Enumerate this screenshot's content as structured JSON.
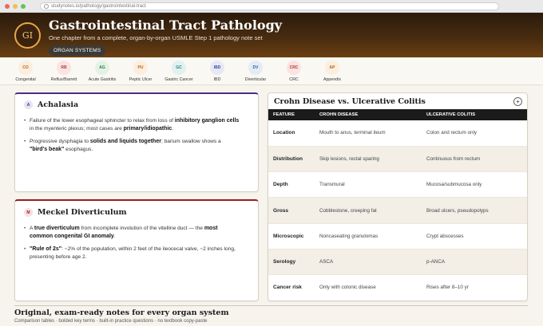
{
  "browser": {
    "url": "studynotes.io/pathology/gastrointestinal-tract"
  },
  "hero": {
    "badge": "GI",
    "title": "Gastrointestinal Tract Pathology",
    "subtitle": "One chapter from a complete, organ-by-organ USMLE Step 1 pathology note set",
    "pill": "ORGAN SYSTEMS"
  },
  "nav": [
    {
      "abbr": "CO",
      "label": "Congenital",
      "bg": "#fbeede",
      "fg": "#b5651d"
    },
    {
      "abbr": "RB",
      "label": "Reflux/Barrett",
      "bg": "#fbe3e3",
      "fg": "#b33a3a"
    },
    {
      "abbr": "AG",
      "label": "Acute Gastritis",
      "bg": "#e3f2e6",
      "fg": "#2f7d3e"
    },
    {
      "abbr": "PU",
      "label": "Peptic Ulcer",
      "bg": "#fbeede",
      "fg": "#b5651d"
    },
    {
      "abbr": "GC",
      "label": "Gastric Cancer",
      "bg": "#dff1f0",
      "fg": "#2a7f7a"
    },
    {
      "abbr": "IBD",
      "label": "IBD",
      "bg": "#e6e8f6",
      "fg": "#3e4a9b"
    },
    {
      "abbr": "DV",
      "label": "Diverticular",
      "bg": "#e3ecf6",
      "fg": "#3a6396"
    },
    {
      "abbr": "CRC",
      "label": "CRC",
      "bg": "#fbe3e3",
      "fg": "#b33a3a"
    },
    {
      "abbr": "AP",
      "label": "Appendix",
      "bg": "#fbeede",
      "fg": "#b5651d"
    }
  ],
  "achalasia": {
    "chip": "A",
    "title": "Achalasia",
    "b1": {
      "t1": "Failure of the lower esophageal sphincter to relax from loss of ",
      "k1": "inhibitory ganglion cells",
      "t2": " in the myenteric plexus; most cases are ",
      "k2": "primary/idiopathic",
      "t3": "."
    },
    "b2": {
      "t1": "Progressive dysphagia to ",
      "k1": "solids and liquids together",
      "t2": "; barium swallow shows a ",
      "k2": "\"bird's beak\"",
      "t3": " esophagus."
    }
  },
  "meckel": {
    "chip": "M",
    "title": "Meckel Diverticulum",
    "b1": {
      "t1": "A ",
      "k1": "true diverticulum",
      "t2": " from incomplete involution of the vitelline duct — the ",
      "k2": "most common congenital GI anomaly",
      "t3": "."
    },
    "b2": {
      "k1": "\"Rule of 2s\"",
      "t1": ": ~2% of the population, within 2 feet of the ileocecal valve, ~2 inches long, presenting before age 2."
    }
  },
  "comparison": {
    "title": "Crohn Disease vs. Ulcerative Colitis",
    "plus": "+",
    "headers": [
      "FEATURE",
      "CROHN DISEASE",
      "ULCERATIVE COLITIS"
    ],
    "rows": [
      [
        "Location",
        "Mouth to anus, terminal ileum",
        "Colon and rectum only"
      ],
      [
        "Distribution",
        "Skip lesions, rectal sparing",
        "Continuous from rectum"
      ],
      [
        "Depth",
        "Transmural",
        "Mucosa/submucosa only"
      ],
      [
        "Gross",
        "Cobblestone, creeping fat",
        "Broad ulcers, pseudopolyps"
      ],
      [
        "Microscopic",
        "Noncaseating granulomas",
        "Crypt abscesses"
      ],
      [
        "Serology",
        "ASCA",
        "p-ANCA"
      ],
      [
        "Cancer risk",
        "Only with colonic disease",
        "Rises after 8–10 yr"
      ]
    ]
  },
  "footer": {
    "title": "Original, exam-ready notes for every organ system",
    "subtitle": "Comparison tables · bolded key terms · built-in practice questions · no textbook copy-paste"
  }
}
